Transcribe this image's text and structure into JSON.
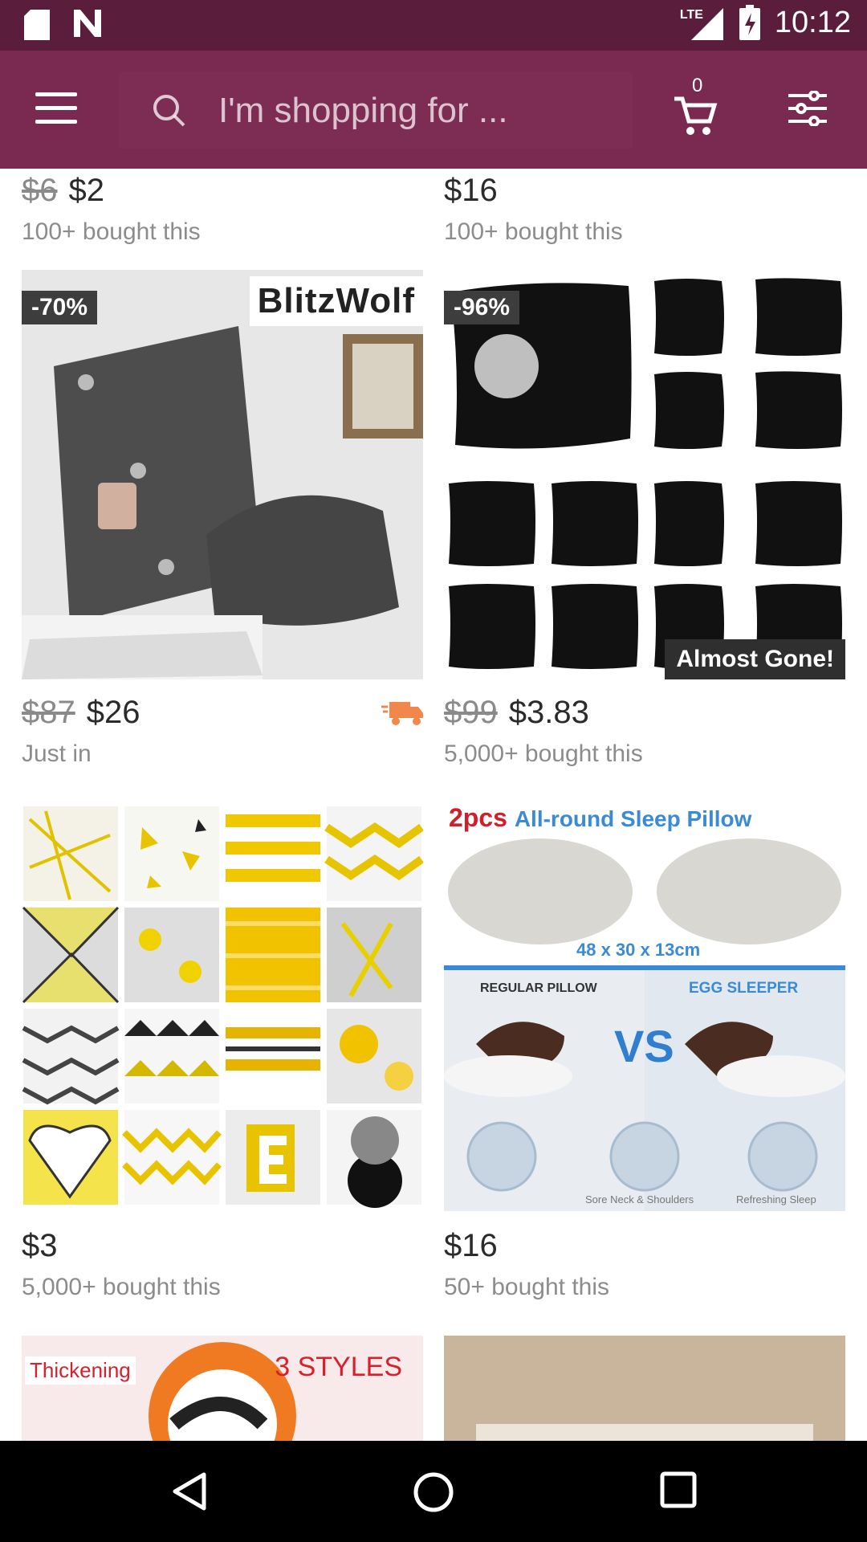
{
  "status": {
    "time": "10:12",
    "network": "LTE"
  },
  "appbar": {
    "search_placeholder": "I'm shopping for ...",
    "cart_count": "0"
  },
  "products": [
    {
      "old_price": "$6",
      "price": "$2",
      "meta": "100+ bought this"
    },
    {
      "old_price": "",
      "price": "$16",
      "meta": "100+ bought this"
    },
    {
      "old_price": "$87",
      "price": "$26",
      "meta": "Just in",
      "discount": "-70%",
      "brand": "BlitzWolf"
    },
    {
      "old_price": "$99",
      "price": "$3.83",
      "meta": "5,000+ bought this",
      "discount": "-96%",
      "flag": "Almost Gone!"
    },
    {
      "old_price": "",
      "price": "$3",
      "meta": "5,000+ bought this"
    },
    {
      "old_price": "",
      "price": "$16",
      "meta": "50+ bought this",
      "title1": "2pcs",
      "title2": "All-round Sleep Pillow",
      "dims": "48 x 30 x 13cm",
      "label_a": "REGULAR PILLOW",
      "label_b": "EGG SLEEPER",
      "vs": "VS",
      "caption_a": "Sore Neck & Shoulders",
      "caption_b": "Refreshing Sleep"
    },
    {
      "banner_left": "Thickening",
      "banner_right": "3 STYLES"
    }
  ],
  "colors": {
    "statusbar": "#5b1d3c",
    "appbar": "#7a2a50",
    "navbar": "#000000"
  }
}
